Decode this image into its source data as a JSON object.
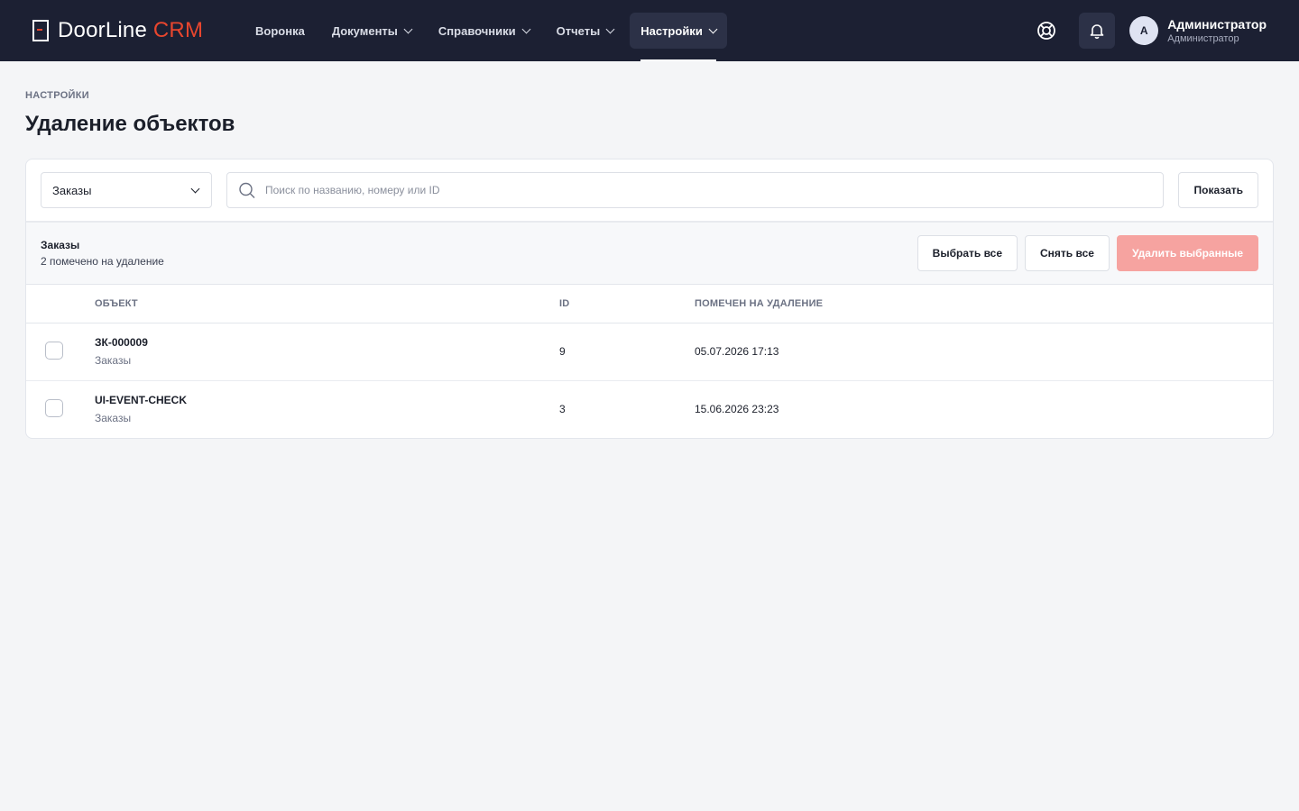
{
  "brand": {
    "name": "DoorLine",
    "accent_word": "CRM",
    "accent_color": "#e8462e"
  },
  "nav": {
    "items": [
      {
        "label": "Воронка",
        "has_dropdown": false
      },
      {
        "label": "Документы",
        "has_dropdown": true
      },
      {
        "label": "Справочники",
        "has_dropdown": true
      },
      {
        "label": "Отчеты",
        "has_dropdown": true
      },
      {
        "label": "Настройки",
        "has_dropdown": true,
        "active": true
      }
    ]
  },
  "header_icons": {
    "support": "lifebuoy-icon",
    "notifications": "bell-icon"
  },
  "user": {
    "initial": "A",
    "name": "Администратор",
    "role": "Администратор"
  },
  "page": {
    "eyebrow": "НАСТРОЙКИ",
    "title": "Удаление объектов"
  },
  "filters": {
    "object_type": "Заказы",
    "search_placeholder": "Поиск по названию, номеру или ID",
    "search_value": "",
    "show_button": "Показать"
  },
  "summary": {
    "title": "Заказы",
    "subtitle": "2 помечено на удаление",
    "select_all": "Выбрать все",
    "deselect_all": "Снять все",
    "delete_selected": "Удалить выбранные"
  },
  "table": {
    "columns": {
      "object": "ОБЪЕКТ",
      "id": "ID",
      "marked": "ПОМЕЧЕН НА УДАЛЕНИЕ"
    },
    "rows": [
      {
        "name": "ЗК-000009",
        "type": "Заказы",
        "id": "9",
        "marked": "05.07.2026 17:13",
        "checked": false
      },
      {
        "name": "UI-EVENT-CHECK",
        "type": "Заказы",
        "id": "3",
        "marked": "15.06.2026 23:23",
        "checked": false
      }
    ]
  }
}
